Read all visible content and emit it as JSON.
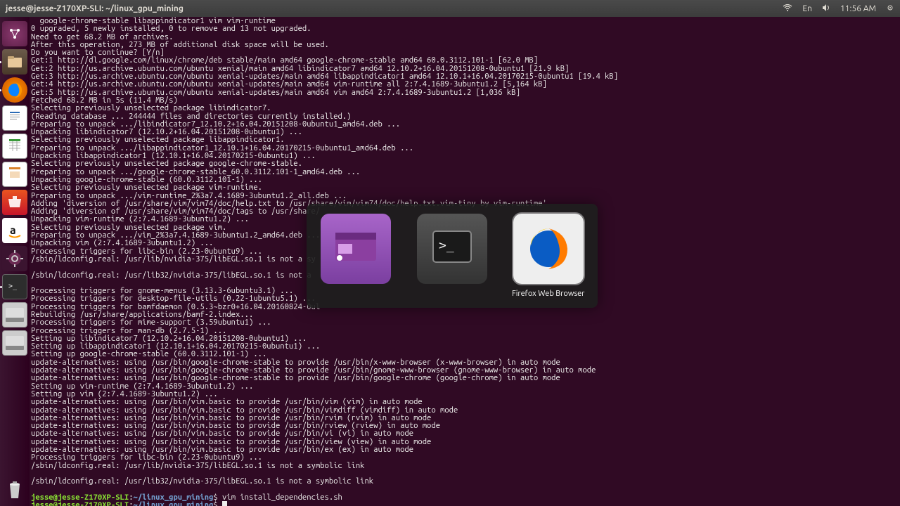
{
  "topbar": {
    "title": "jesse@jesse-Z170XP-SLI: ~/linux_gpu_mining",
    "lang": "En",
    "time": "11:56 AM"
  },
  "launcher": {
    "items": [
      {
        "name": "dash",
        "label": "Dash"
      },
      {
        "name": "files",
        "label": "Files"
      },
      {
        "name": "firefox",
        "label": "Firefox"
      },
      {
        "name": "writer",
        "label": "Writer"
      },
      {
        "name": "calc",
        "label": "Calc"
      },
      {
        "name": "impress",
        "label": "Impress"
      },
      {
        "name": "software",
        "label": "Ubuntu Software"
      },
      {
        "name": "amazon",
        "label": "Amazon"
      },
      {
        "name": "settings",
        "label": "System Settings"
      },
      {
        "name": "terminal",
        "label": "Terminal"
      },
      {
        "name": "device1",
        "label": "Device"
      },
      {
        "name": "device2",
        "label": "Device"
      }
    ],
    "trash": "Trash"
  },
  "switcher": {
    "items": [
      {
        "name": "screenrec",
        "label": ""
      },
      {
        "name": "terminal",
        "label": ""
      },
      {
        "name": "firefox",
        "label": "Firefox Web Browser"
      }
    ]
  },
  "terminal_lines": [
    "  google-chrome-stable libappindicator1 vim vim-runtime",
    "0 upgraded, 5 newly installed, 0 to remove and 13 not upgraded.",
    "Need to get 68.2 MB of archives.",
    "After this operation, 273 MB of additional disk space will be used.",
    "Do you want to continue? [Y/n]",
    "Get:1 http://dl.google.com/linux/chrome/deb stable/main amd64 google-chrome-stable amd64 60.0.3112.101-1 [62.0 MB]",
    "Get:2 http://us.archive.ubuntu.com/ubuntu xenial/main amd64 libindicator7 amd64 12.10.2+16.04.20151208-0ubuntu1 [21.9 kB]",
    "Get:3 http://us.archive.ubuntu.com/ubuntu xenial-updates/main amd64 libappindicator1 amd64 12.10.1+16.04.20170215-0ubuntu1 [19.4 kB]",
    "Get:4 http://us.archive.ubuntu.com/ubuntu xenial-updates/main amd64 vim-runtime all 2:7.4.1689-3ubuntu1.2 [5,164 kB]",
    "Get:5 http://us.archive.ubuntu.com/ubuntu xenial-updates/main amd64 vim amd64 2:7.4.1689-3ubuntu1.2 [1,036 kB]",
    "Fetched 68.2 MB in 5s (11.4 MB/s)",
    "Selecting previously unselected package libindicator7.",
    "(Reading database ... 244444 files and directories currently installed.)",
    "Preparing to unpack .../libindicator7_12.10.2+16.04.20151208-0ubuntu1_amd64.deb ...",
    "Unpacking libindicator7 (12.10.2+16.04.20151208-0ubuntu1) ...",
    "Selecting previously unselected package libappindicator1.",
    "Preparing to unpack .../libappindicator1_12.10.1+16.04.20170215-0ubuntu1_amd64.deb ...",
    "Unpacking libappindicator1 (12.10.1+16.04.20170215-0ubuntu1) ...",
    "Selecting previously unselected package google-chrome-stable.",
    "Preparing to unpack .../google-chrome-stable_60.0.3112.101-1_amd64.deb ...",
    "Unpacking google-chrome-stable (60.0.3112.101-1) ...",
    "Selecting previously unselected package vim-runtime.",
    "Preparing to unpack .../vim-runtime_2%3a7.4.1689-3ubuntu1.2_all.deb ...",
    "Adding 'diversion of /usr/share/vim/vim74/doc/help.txt to /usr/share/vim/vim74/doc/help.txt.vim-tiny by vim-runtime'",
    "Adding 'diversion of /usr/share/vim/vim74/doc/tags to /usr/share/",
    "Unpacking vim-runtime (2:7.4.1689-3ubuntu1.2) ...",
    "Selecting previously unselected package vim.",
    "Preparing to unpack .../vim_2%3a7.4.1689-3ubuntu1.2_amd64.deb ...",
    "Unpacking vim (2:7.4.1689-3ubuntu1.2) ...",
    "Processing triggers for libc-bin (2.23-0ubuntu9) ...",
    "/sbin/ldconfig.real: /usr/lib/nvidia-375/libEGL.so.1 is not a sy",
    "",
    "/sbin/ldconfig.real: /usr/lib32/nvidia-375/libEGL.so.1 is not a ",
    "",
    "Processing triggers for gnome-menus (3.13.3-6ubuntu3.1) ...",
    "Processing triggers for desktop-file-utils (0.22-1ubuntu5.1) ...",
    "Processing triggers for bamfdaemon (0.5.3~bzr0+16.04.20160824-0ul",
    "Rebuilding /usr/share/applications/bamf-2.index...",
    "Processing triggers for mime-support (3.59ubuntu1) ...",
    "Processing triggers for man-db (2.7.5-1) ...",
    "Setting up libindicator7 (12.10.2+16.04.20151208-0ubuntu1) ...",
    "Setting up libappindicator1 (12.10.1+16.04.20170215-0ubuntu1) ...",
    "Setting up google-chrome-stable (60.0.3112.101-1) ...",
    "update-alternatives: using /usr/bin/google-chrome-stable to provide /usr/bin/x-www-browser (x-www-browser) in auto mode",
    "update-alternatives: using /usr/bin/google-chrome-stable to provide /usr/bin/gnome-www-browser (gnome-www-browser) in auto mode",
    "update-alternatives: using /usr/bin/google-chrome-stable to provide /usr/bin/google-chrome (google-chrome) in auto mode",
    "Setting up vim-runtime (2:7.4.1689-3ubuntu1.2) ...",
    "Setting up vim (2:7.4.1689-3ubuntu1.2) ...",
    "update-alternatives: using /usr/bin/vim.basic to provide /usr/bin/vim (vim) in auto mode",
    "update-alternatives: using /usr/bin/vim.basic to provide /usr/bin/vimdiff (vimdiff) in auto mode",
    "update-alternatives: using /usr/bin/vim.basic to provide /usr/bin/rvim (rvim) in auto mode",
    "update-alternatives: using /usr/bin/vim.basic to provide /usr/bin/rview (rview) in auto mode",
    "update-alternatives: using /usr/bin/vim.basic to provide /usr/bin/vi (vi) in auto mode",
    "update-alternatives: using /usr/bin/vim.basic to provide /usr/bin/view (view) in auto mode",
    "update-alternatives: using /usr/bin/vim.basic to provide /usr/bin/ex (ex) in auto mode",
    "Processing triggers for libc-bin (2.23-0ubuntu9) ...",
    "/sbin/ldconfig.real: /usr/lib/nvidia-375/libEGL.so.1 is not a symbolic link",
    "",
    "/sbin/ldconfig.real: /usr/lib32/nvidia-375/libEGL.so.1 is not a symbolic link",
    ""
  ],
  "prompt": {
    "user": "jesse@jesse-Z170XP-SLI",
    "colon": ":",
    "path": "~/linux_gpu_mining",
    "dollar": "$ ",
    "cmd1": "vim install_dependencies.sh",
    "cmd2": ""
  }
}
